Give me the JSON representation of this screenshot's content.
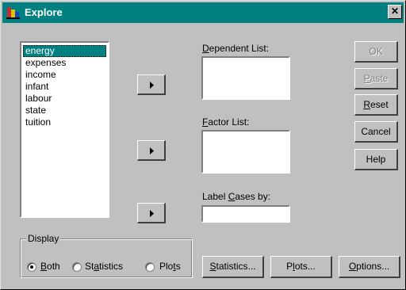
{
  "window": {
    "title": "Explore",
    "close_glyph": "✕"
  },
  "variables": [
    "energy",
    "expenses",
    "income",
    "infant",
    "labour",
    "state",
    "tuition"
  ],
  "dependent_list": {
    "label_u": "D",
    "label_rest": "ependent List:"
  },
  "factor_list": {
    "label_u": "F",
    "label_rest": "actor List:"
  },
  "label_cases": {
    "label_pre": "Label ",
    "label_u": "C",
    "label_rest": "ases by:"
  },
  "side_buttons": {
    "ok": "OK",
    "paste_u": "P",
    "paste_rest": "aste",
    "reset_u": "R",
    "reset_rest": "eset",
    "cancel": "Cancel",
    "help": "Help"
  },
  "display": {
    "title": "Display",
    "both_u": "B",
    "both_rest": "oth",
    "statistics_pre": "St",
    "statistics_u": "a",
    "statistics_rest": "tistics",
    "plots_pre": "Plo",
    "plots_u": "t",
    "plots_rest": "s",
    "selected": "Both"
  },
  "bottom_buttons": {
    "statistics_u": "S",
    "statistics_rest": "tatistics...",
    "plots_pre": "P",
    "plots_u": "l",
    "plots_rest": "ots...",
    "options_u": "O",
    "options_rest": "ptions..."
  },
  "colors": {
    "titlebar": "#008080",
    "face": "#c0c0c0",
    "selection": "#008080"
  }
}
